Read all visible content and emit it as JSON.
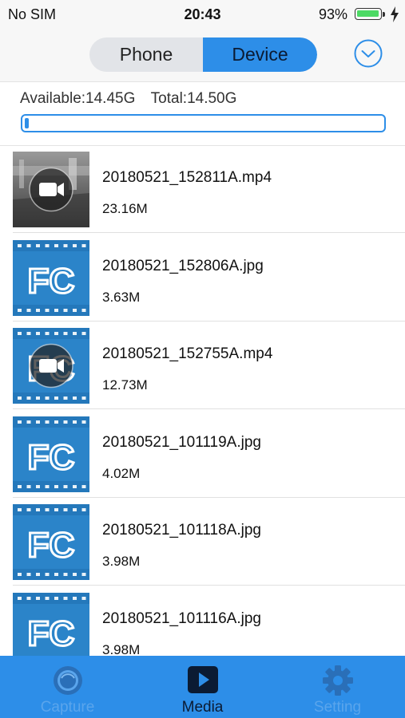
{
  "status_bar": {
    "carrier": "No SIM",
    "time": "20:43",
    "battery_percent": "93%",
    "battery_level": 0.93,
    "charging": true
  },
  "header": {
    "segments": [
      {
        "label": "Phone",
        "selected": false
      },
      {
        "label": "Device",
        "selected": true
      }
    ],
    "dropdown_icon": "chevron-down-circle-icon"
  },
  "storage": {
    "available": "Available:14.45G",
    "total": "Total:14.50G",
    "used_fraction": 0.003
  },
  "files": [
    {
      "name": "20180521_152811A.mp4",
      "size": "23.16M",
      "type": "video",
      "thumb": "dashcam-photo"
    },
    {
      "name": "20180521_152806A.jpg",
      "size": "3.63M",
      "type": "image",
      "thumb": "fc-logo"
    },
    {
      "name": "20180521_152755A.mp4",
      "size": "12.73M",
      "type": "video",
      "thumb": "fc-logo"
    },
    {
      "name": "20180521_101119A.jpg",
      "size": "4.02M",
      "type": "image",
      "thumb": "fc-logo"
    },
    {
      "name": "20180521_101118A.jpg",
      "size": "3.98M",
      "type": "image",
      "thumb": "fc-logo"
    },
    {
      "name": "20180521_101116A.jpg",
      "size": "3.98M",
      "type": "image",
      "thumb": "fc-logo"
    }
  ],
  "thumb_logo_text": "FC",
  "tabbar": {
    "tabs": [
      {
        "label": "Capture",
        "icon": "camera-lens-icon",
        "selected": false
      },
      {
        "label": "Media",
        "icon": "play-icon",
        "selected": true
      },
      {
        "label": "Setting",
        "icon": "gear-icon",
        "selected": false
      }
    ]
  },
  "colors": {
    "accent": "#2d8ee8",
    "thumb_blue": "#2b84c9",
    "battery_green": "#4cd964"
  }
}
